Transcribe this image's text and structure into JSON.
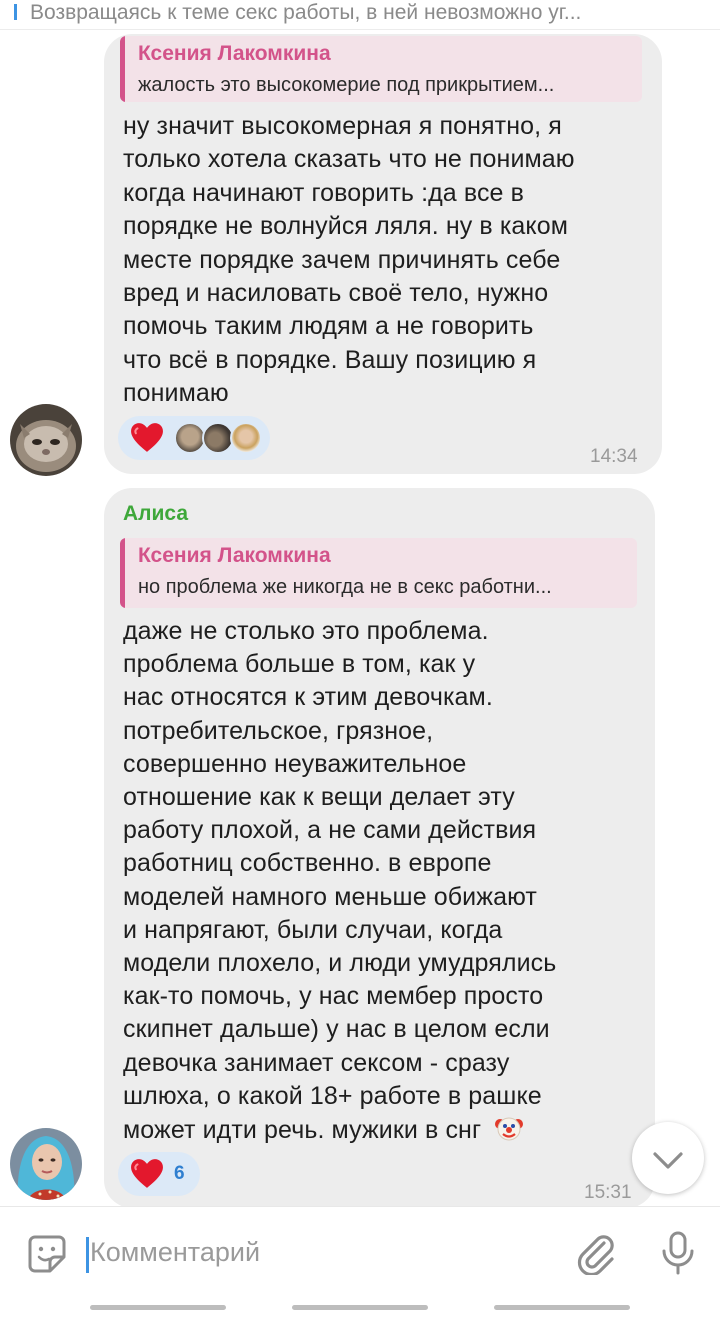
{
  "pinned": {
    "text": "Возвращаясь к теме секс работы, в ней невозможно уг..."
  },
  "messages": [
    {
      "reply": {
        "author": "Ксения Лакомкина",
        "snippet": "жалость это высокомерие под прикрытием..."
      },
      "lines": [
        "ну значит высокомерная я понятно, я",
        "только хотела сказать что не понимаю",
        "когда начинают говорить :да все в",
        "порядке не волнуйся ляля. ну в каком",
        "месте порядке зачем причинять себе",
        "вред и насиловать своё тело, нужно",
        "помочь таким людям а не говорить",
        "что всё в порядке. Вашу позицию я",
        "понимаю"
      ],
      "reaction": {
        "emoji": "heart",
        "avatars": [
          "cat-avatar",
          "cats-avatar",
          "woman-avatar"
        ]
      },
      "time": "14:34"
    },
    {
      "sender": "Алиса",
      "reply": {
        "author": "Ксения Лакомкина",
        "snippet": "но проблема же никогда не в секс работни..."
      },
      "lines": [
        "даже не столько это проблема.",
        "проблема больше в том, как у",
        "нас относятся к этим девочкам.",
        "потребительское, грязное,",
        "совершенно неуважительное",
        "отношение как к вещи делает эту",
        "работу плохой, а не сами действия",
        "работниц собственно. в европе",
        "моделей намного меньше обижают",
        "и напрягают, были случаи, когда",
        "модели плохело, и люди умудрялись",
        "как-то помочь, у нас мембер просто",
        "скипнет дальше) у нас в целом если",
        "девочка занимает сексом - сразу",
        "шлюха, о какой 18+ работе в рашке",
        "может идти речь. мужики в снг"
      ],
      "trailing_emoji": "clown-face",
      "reaction": {
        "emoji": "heart",
        "count": "6"
      },
      "time": "15:31"
    }
  ],
  "composer": {
    "placeholder": "Комментарий"
  },
  "colors": {
    "bubble": "#ededed",
    "reply_bg": "#f3e2e8",
    "reply_accent": "#d3538a",
    "sender_name": "#3ea83a",
    "reaction_bg": "#dce9f7",
    "link_blue": "#3d94e3"
  }
}
